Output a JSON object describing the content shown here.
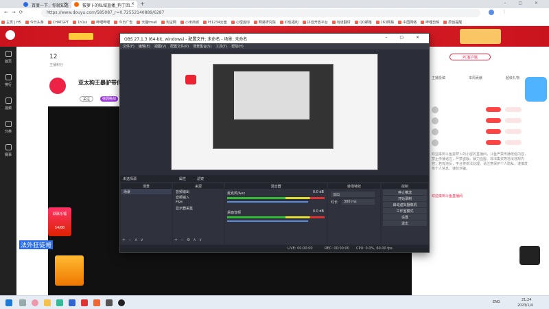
{
  "browser": {
    "tabs": [
      {
        "label": "百度一下，你就知道"
      },
      {
        "label": "拔萝卜的私域直播_狗丁回..."
      }
    ],
    "url": "https://www.douyu.com/585087_r=0.72552140889/6287",
    "bookmarks": [
      "主页 | H5",
      "今日头条",
      "CHATGPT",
      "1h1ui",
      "哔哩哔哩",
      "今日广告",
      "天猫tmall",
      "淘宝网",
      "小米商城",
      "叶1234云盘",
      "心理咨询",
      "网易研究院",
      "红包福利",
      "抖音开放平台",
      "有道翻译",
      "QQ邮箱",
      "163网易",
      "中国网络",
      "哔哩剪辑",
      "原创提醒"
    ]
  },
  "douyu": {
    "followers_count": "12",
    "followers_label": "主播积分",
    "streamer_name": "亚太狗王暴驴带你",
    "follow_label": "关注",
    "badge_label": "强弱挑战",
    "gift_banner": "跃跃乐福",
    "gift_count": "54/88",
    "caption": "法外狂徒哥",
    "right_top_label": "PC客户端",
    "tabs": [
      "主播投稿",
      "本周贡献",
      "超级礼物"
    ],
    "chat_header": "欢迎来到斗鱼直播间",
    "chat_text": "欢迎来到斗鱼拔萝卜的小屋的直播间，斗鱼严禁传播低俗内容，禁止传播谣言，严禁盗版、暴力血腥、非法集资等违法违规内容；若有违反，平台将依法处理。请注意保护个人隐私，谨慎发布个人信息、谨防诈骗。"
  },
  "obs": {
    "title": "OBS 27.1.3 (64-bit, windows) - 配置文件: 未命名 - 场景: 未命名",
    "menu": [
      "文件(F)",
      "编辑(E)",
      "视图(V)",
      "配置文件(P)",
      "场景集合(S)",
      "工具(T)",
      "帮助(H)"
    ],
    "no_source_label": "未选择源",
    "properties_label": "属性",
    "filters_label": "滤镜",
    "panels": {
      "scenes": "场景",
      "sources": "来源",
      "mixer": "混音器",
      "transitions": "转场特效",
      "controls": "控制"
    },
    "scene_items": [
      "场景"
    ],
    "source_items": [
      "音频输出",
      "音频输入",
      "FSH",
      "显示器采集"
    ],
    "mixer_tracks": [
      {
        "name": "麦克风/Aux",
        "db": "0.0 dB"
      },
      {
        "name": "桌面音频",
        "db": "0.0 dB"
      }
    ],
    "transition_type": "淡出",
    "duration_label": "时长",
    "duration_value": "300 ms",
    "control_buttons": [
      "停止推流",
      "开始录制",
      "启动虚拟摄像机",
      "工作室模式",
      "设置",
      "退出"
    ],
    "status": {
      "live": "LIVE: 00:00:00",
      "rec": "REC: 00:00:00",
      "cpu": "CPU: 0.0%, 60.00 fps"
    }
  },
  "taskbar": {
    "lang": "ENG",
    "time": "21:24",
    "date": "2023/1/4"
  },
  "colors": {
    "douyu_red": "#d91d27",
    "obs_bg": "#2b2e38"
  }
}
